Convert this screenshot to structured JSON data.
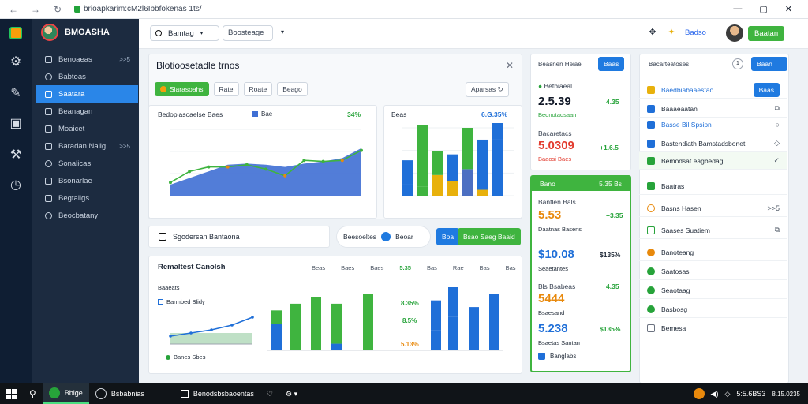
{
  "browser": {
    "url": "brioapkarim:cM2l6Ibbfokenas 1ts/"
  },
  "app": {
    "brand": "BMOASHA"
  },
  "sidebar": {
    "items": [
      {
        "label": "Benoaeas",
        "badge": ">>5"
      },
      {
        "label": "Babtoas",
        "badge": ""
      },
      {
        "label": "Saatara",
        "badge": ""
      },
      {
        "label": "Beanagan",
        "badge": ""
      },
      {
        "label": "Moaicet",
        "badge": ""
      },
      {
        "label": "Baradan Nalig",
        "badge": ">>5"
      },
      {
        "label": "Sonalicas",
        "badge": ""
      },
      {
        "label": "Bsonarlae",
        "badge": ""
      },
      {
        "label": "Begtaligs",
        "badge": ""
      },
      {
        "label": "Beocbatany",
        "badge": ""
      }
    ]
  },
  "topbar": {
    "search_value": "Bamtag",
    "filter_value": "Boosteage",
    "link": "Badso",
    "user_button": "Baatan"
  },
  "main_panel": {
    "title": "Blotioosetadle trnos",
    "tabs": [
      "Siarasoahs",
      "Rate",
      "Roate",
      "Beago"
    ],
    "export_label": "Aparsas"
  },
  "area_chart": {
    "title": "Bedoplasoaelse Baes",
    "legend": "Bae",
    "change": "34%"
  },
  "bar_chart_top": {
    "title": "Beas",
    "change": "6.G.35%"
  },
  "filter_row": {
    "label": "Sgodersan Bantaona",
    "toggle_left": "Beesoeltes",
    "toggle_right": "Beoar",
    "blue_btn": "Boa",
    "green_btn": "Bsao Saeg Baaid"
  },
  "bottom_panel": {
    "title": "Remaltest Canolsh",
    "headers": [
      "Beas",
      "Baes",
      "Baes",
      "Bas",
      "Rae",
      "Bas",
      "Bas"
    ],
    "change_head": "5.35",
    "sub_title": "Baaeats",
    "legend": "Barmbed Blidy",
    "legend2": "Banes Sbes",
    "pct_a": "8.35%",
    "pct_b": "8.5%",
    "pct_c": "5.13%"
  },
  "kpis": {
    "header_label": "Beasnen Heiae",
    "header_button": "Baas",
    "items": [
      {
        "label": "Betbiaeal",
        "value": "2.5.39",
        "change": "4.35",
        "sub": "Beonotadsaan",
        "color": "green"
      },
      {
        "label": "Bacaretacs",
        "value": "5.0309",
        "change": "+1.6.5",
        "sub": "Baaosi Baes",
        "color": "red"
      }
    ],
    "green_card_head": "Bano",
    "green_card_badge": "5.35 Bs",
    "items2": [
      {
        "label": "Bantlen Bals",
        "value": "5.53",
        "change": "+3.35",
        "sub": "Daatnas Basens",
        "color": "orange"
      },
      {
        "label": "",
        "value": "$10.08",
        "change": "$135%",
        "sub": "Seaetantes",
        "color": "blue"
      },
      {
        "label": "Bls Bsabeas",
        "value": "5444",
        "change": "4.35",
        "sub": "Bsaesand",
        "color": "orange"
      },
      {
        "label": "",
        "value": "5.238",
        "change": "$135%",
        "sub": "Bsaetas Santan",
        "color": "blue"
      }
    ],
    "footer": "Banglabs"
  },
  "right_panel": {
    "header": "Bacarteatoses",
    "info": "1",
    "button": "Baan",
    "rows": [
      {
        "label": "Baedbiabaaestao",
        "end": "Baas",
        "color": "#2a86e8"
      },
      {
        "label": "Baaaeaatan",
        "end": "⧉",
        "color": "#1f6fd8"
      },
      {
        "label": "Basse Bil Spsipn",
        "end": "○",
        "color": "#1f6fd8"
      },
      {
        "label": "Bastendiath Bamstadsbonet",
        "end": "◇",
        "color": "#1f6fd8"
      },
      {
        "label": "Bemodsat eagbedag",
        "end": "✓",
        "color": "#27a33a"
      },
      {
        "label": "Baatras",
        "end": "",
        "color": "#27a33a"
      },
      {
        "label": "Basns Hasen",
        "end": ">>5",
        "color": "#e8890c"
      },
      {
        "label": "Saases Suatiem",
        "end": "⧉",
        "color": "#27a33a"
      },
      {
        "label": "Banoteang",
        "end": "",
        "color": "#e8890c"
      },
      {
        "label": "Saatosas",
        "end": "",
        "color": "#27a33a"
      },
      {
        "label": "Seaotaag",
        "end": "",
        "color": "#27a33a"
      },
      {
        "label": "Basbosg",
        "end": "",
        "color": "#27a33a"
      },
      {
        "label": "Bemesa",
        "end": "",
        "color": "#6b7280"
      }
    ]
  },
  "taskbar": {
    "items": [
      "Bbige",
      "Bsbabnias",
      "Benodsbsbaoentas"
    ],
    "time": "5:5.6BS3",
    "date": "8.15.0235"
  },
  "chart_data": [
    {
      "type": "area",
      "title": "Bedoplasoaelse Baes",
      "categories": [
        "",
        "",
        "",
        "",
        "",
        "",
        "",
        "",
        "",
        "",
        ""
      ],
      "series": [
        {
          "values": [
            50,
            80,
            110,
            140,
            145,
            140,
            130,
            145,
            155,
            170,
            215
          ]
        },
        {
          "name": "Bae",
          "values": [
            60,
            110,
            130,
            130,
            140,
            120,
            90,
            160,
            155,
            160,
            205
          ]
        }
      ],
      "ylim": [
        0,
        300
      ]
    },
    {
      "type": "bar",
      "title": "Beas",
      "series": [
        {
          "values": [
            80,
            210,
            80,
            90,
            140,
            170,
            120
          ]
        },
        {
          "values": [
            40,
            30,
            70,
            50,
            90,
            20,
            190
          ]
        }
      ]
    },
    {
      "type": "bar",
      "title": "Remaltest Canolsh",
      "series": [
        {
          "values": [
            20,
            70,
            80,
            60,
            85,
            45,
            55,
            65,
            85
          ]
        },
        {
          "values": [
            40,
            0,
            0,
            10,
            0,
            30,
            50,
            0,
            0
          ]
        }
      ]
    }
  ]
}
